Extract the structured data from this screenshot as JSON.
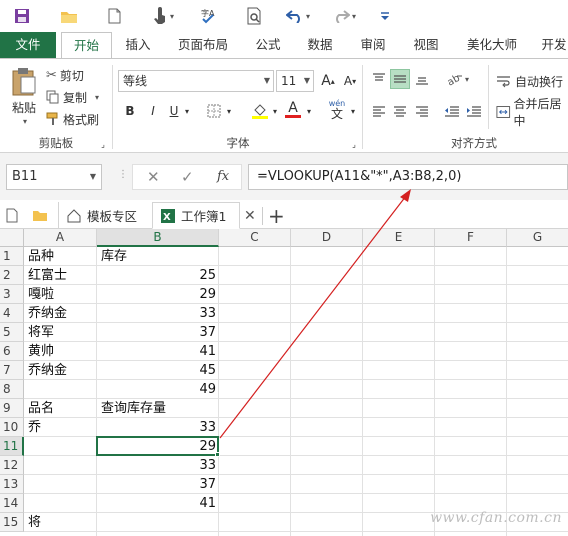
{
  "ribbon_tabs": [
    "文件",
    "开始",
    "插入",
    "页面布局",
    "公式",
    "数据",
    "审阅",
    "视图",
    "美化大师",
    "开发"
  ],
  "clipboard": {
    "paste": "粘贴",
    "cut": "剪切",
    "copy": "复制",
    "format_painter": "格式刷",
    "group": "剪贴板"
  },
  "font": {
    "name": "等线",
    "size": "11",
    "group": "字体",
    "grow": "A",
    "shrink": "A",
    "bold": "B",
    "italic": "I",
    "underline": "U",
    "font_color_letter": "A",
    "phonetic": "wén"
  },
  "alignment": {
    "wrap": "自动换行",
    "merge": "合并后居中",
    "group": "对齐方式"
  },
  "formula_bar": {
    "name_box": "B11",
    "fx": "fx",
    "formula": "=VLOOKUP(A11&\"*\",A3:B8,2,0)"
  },
  "doc_tabs": {
    "template": "模板专区",
    "workbook": "工作簿1",
    "add": "+"
  },
  "sheet": {
    "columns": [
      "A",
      "B",
      "C",
      "D",
      "E",
      "F",
      "G"
    ],
    "rows": [
      "1",
      "2",
      "3",
      "4",
      "5",
      "6",
      "7",
      "8",
      "9",
      "10",
      "11",
      "12",
      "13",
      "14",
      "15"
    ],
    "cells": {
      "A1": "品种",
      "B1": "库存",
      "A2": "红富士",
      "B2": "25",
      "A3": "嘎啦",
      "B3": "29",
      "A4": "乔纳金",
      "B4": "33",
      "A5": "将军",
      "B5": "37",
      "A6": "黄帅",
      "B6": "41",
      "A7": "乔纳金",
      "B7": "45",
      "B8": "49",
      "A9": "品名",
      "B9": "查询库存量",
      "A10": "乔",
      "B10": "33",
      "B11": "29",
      "B12": "33",
      "B13": "37",
      "B14": "41",
      "A15": "将"
    },
    "active_cell": "B11"
  },
  "watermark": "www.cfan.com.cn",
  "colors": {
    "accent": "#217346",
    "arrow": "#d42020"
  }
}
